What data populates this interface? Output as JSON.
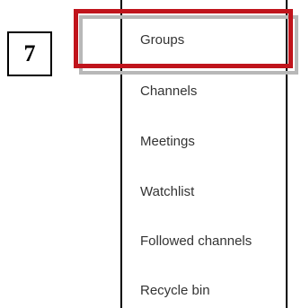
{
  "step_badge": {
    "number": "7"
  },
  "nav": {
    "items": [
      {
        "label": "Groups",
        "highlighted": true
      },
      {
        "label": "Channels"
      },
      {
        "label": "Meetings"
      },
      {
        "label": "Watchlist"
      },
      {
        "label": "Followed channels"
      },
      {
        "label": "Recycle bin"
      }
    ]
  },
  "colors": {
    "highlight": "#c0141c",
    "highlight_shadow": "#b8b8b8",
    "text": "#333333"
  }
}
